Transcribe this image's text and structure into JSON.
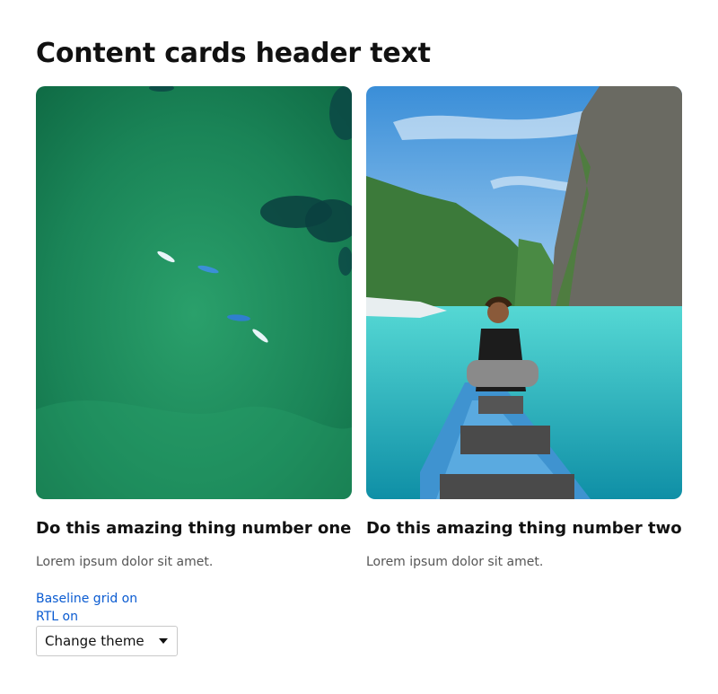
{
  "page": {
    "title": "Content cards header text"
  },
  "cards": [
    {
      "title": "Do this amazing thing number one",
      "body": "Lorem ipsum dolor sit amet."
    },
    {
      "title": "Do this amazing thing number two",
      "body": "Lorem ipsum dolor sit amet."
    }
  ],
  "controls": {
    "baseline_link": "Baseline grid on",
    "rtl_link": "RTL on",
    "theme_select": "Change theme"
  },
  "colors": {
    "link": "#0a5bd1",
    "sea": "#1e8a5a",
    "sky": "#5aa8e6",
    "lagoon": "#28c2c8",
    "boat": "#2f86c9"
  },
  "icons": {
    "select_caret": "caret-down-icon"
  }
}
